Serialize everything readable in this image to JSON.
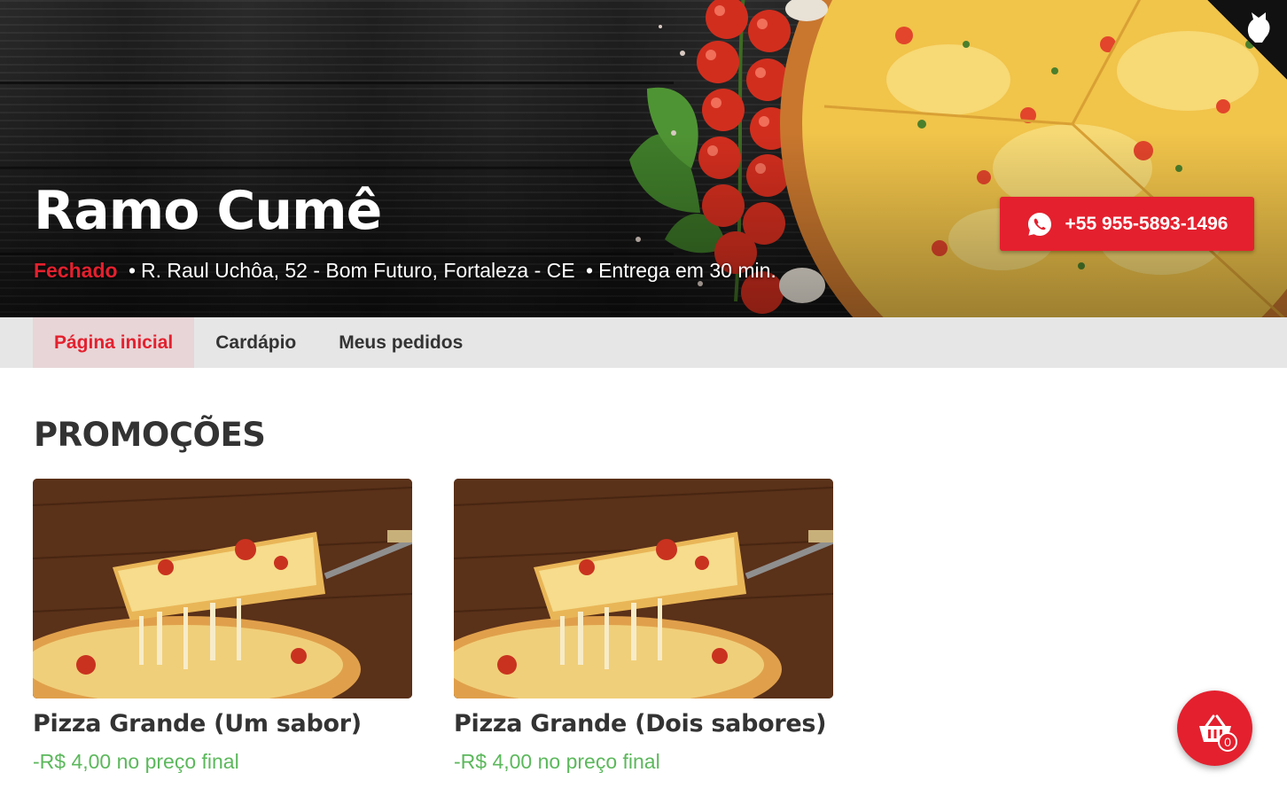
{
  "header": {
    "store_name": "Ramo Cumê",
    "status": "Fechado",
    "separator": "•",
    "address": "R. Raul Uchôa, 52 - Bom Futuro, Fortaleza - CE",
    "delivery": "Entrega em 30 min.",
    "whatsapp_number": "+55 955-5893-1496"
  },
  "nav": {
    "tabs": [
      {
        "label": "Página inicial",
        "active": true
      },
      {
        "label": "Cardápio",
        "active": false
      },
      {
        "label": "Meus pedidos",
        "active": false
      }
    ]
  },
  "promotions": {
    "title": "PROMOÇÕES",
    "items": [
      {
        "name": "Pizza Grande (Um sabor)",
        "discount": "-R$ 4,00 no preço final"
      },
      {
        "name": "Pizza Grande (Dois sabores)",
        "discount": "-R$ 4,00 no preço final"
      }
    ]
  },
  "cart": {
    "count": "0",
    "icon": "shopping-basket-icon"
  },
  "icons": {
    "whatsapp": "whatsapp-icon",
    "badge": "mascot-icon"
  },
  "colors": {
    "accent": "#e4202e",
    "promo": "#5cb85c",
    "nav_bg": "#e6e6e6",
    "active_tab_bg": "#e7d5d7"
  }
}
